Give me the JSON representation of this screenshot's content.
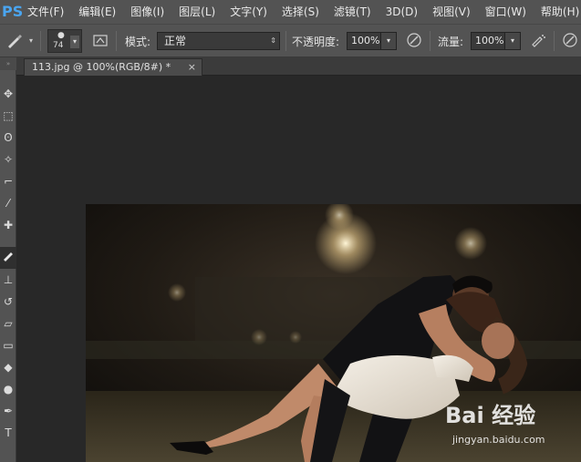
{
  "app": {
    "logo": "PS"
  },
  "menubar": {
    "items": [
      "文件(F)",
      "编辑(E)",
      "图像(I)",
      "图层(L)",
      "文字(Y)",
      "选择(S)",
      "滤镜(T)",
      "3D(D)",
      "视图(V)",
      "窗口(W)",
      "帮助(H)"
    ]
  },
  "options": {
    "brush_size": "74",
    "mode_label": "模式:",
    "mode_value": "正常",
    "opacity_label": "不透明度:",
    "opacity_value": "100%",
    "flow_label": "流量:",
    "flow_value": "100%"
  },
  "document": {
    "tab_title": "113.jpg @ 100%(RGB/8#) *",
    "close_glyph": "×"
  },
  "watermark": {
    "brand": "Bai 经验",
    "url": "jingyan.baidu.com"
  },
  "colors": {
    "chrome": "#535353",
    "workspace": "#282828",
    "accent_logo": "#4aa5f0"
  }
}
